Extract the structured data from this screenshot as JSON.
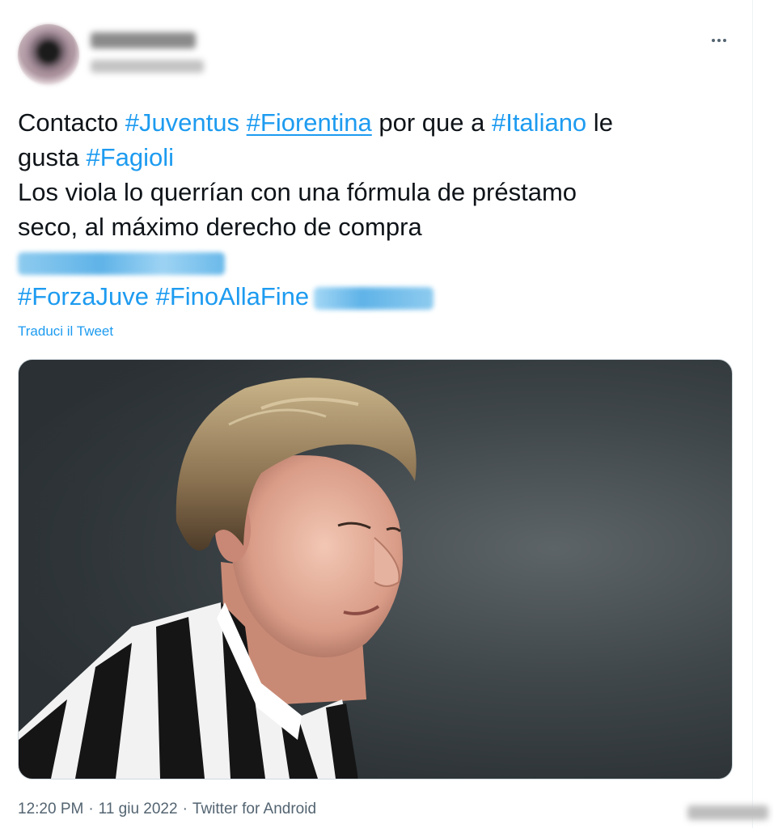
{
  "tweet": {
    "more_icon": "more-horizontal-icon",
    "text_lines": {
      "l1_pre": "Contacto ",
      "l1_tag1": "#Juventus",
      "l1_tag2": "#Fiorentina",
      "l1_mid": " por que a ",
      "l1_tag3": "#Italiano",
      "l1_post": " le",
      "l2_pre": "gusta ",
      "l2_tag": "#Fagioli",
      "l3": "Los viola lo querrían con una fórmula de préstamo",
      "l4": "seco, al máximo derecho de compra",
      "l6_tag1": "#ForzaJuve",
      "l6_tag2": "#FinoAllaFine"
    },
    "translate_link": "Traduci il Tweet",
    "meta": {
      "time": "12:20 PM",
      "date": "11 giu 2022",
      "separator": "·",
      "source": "Twitter for Android"
    }
  },
  "colors": {
    "link": "#1d9bf0",
    "text": "#0f1419",
    "secondary": "#536471"
  }
}
